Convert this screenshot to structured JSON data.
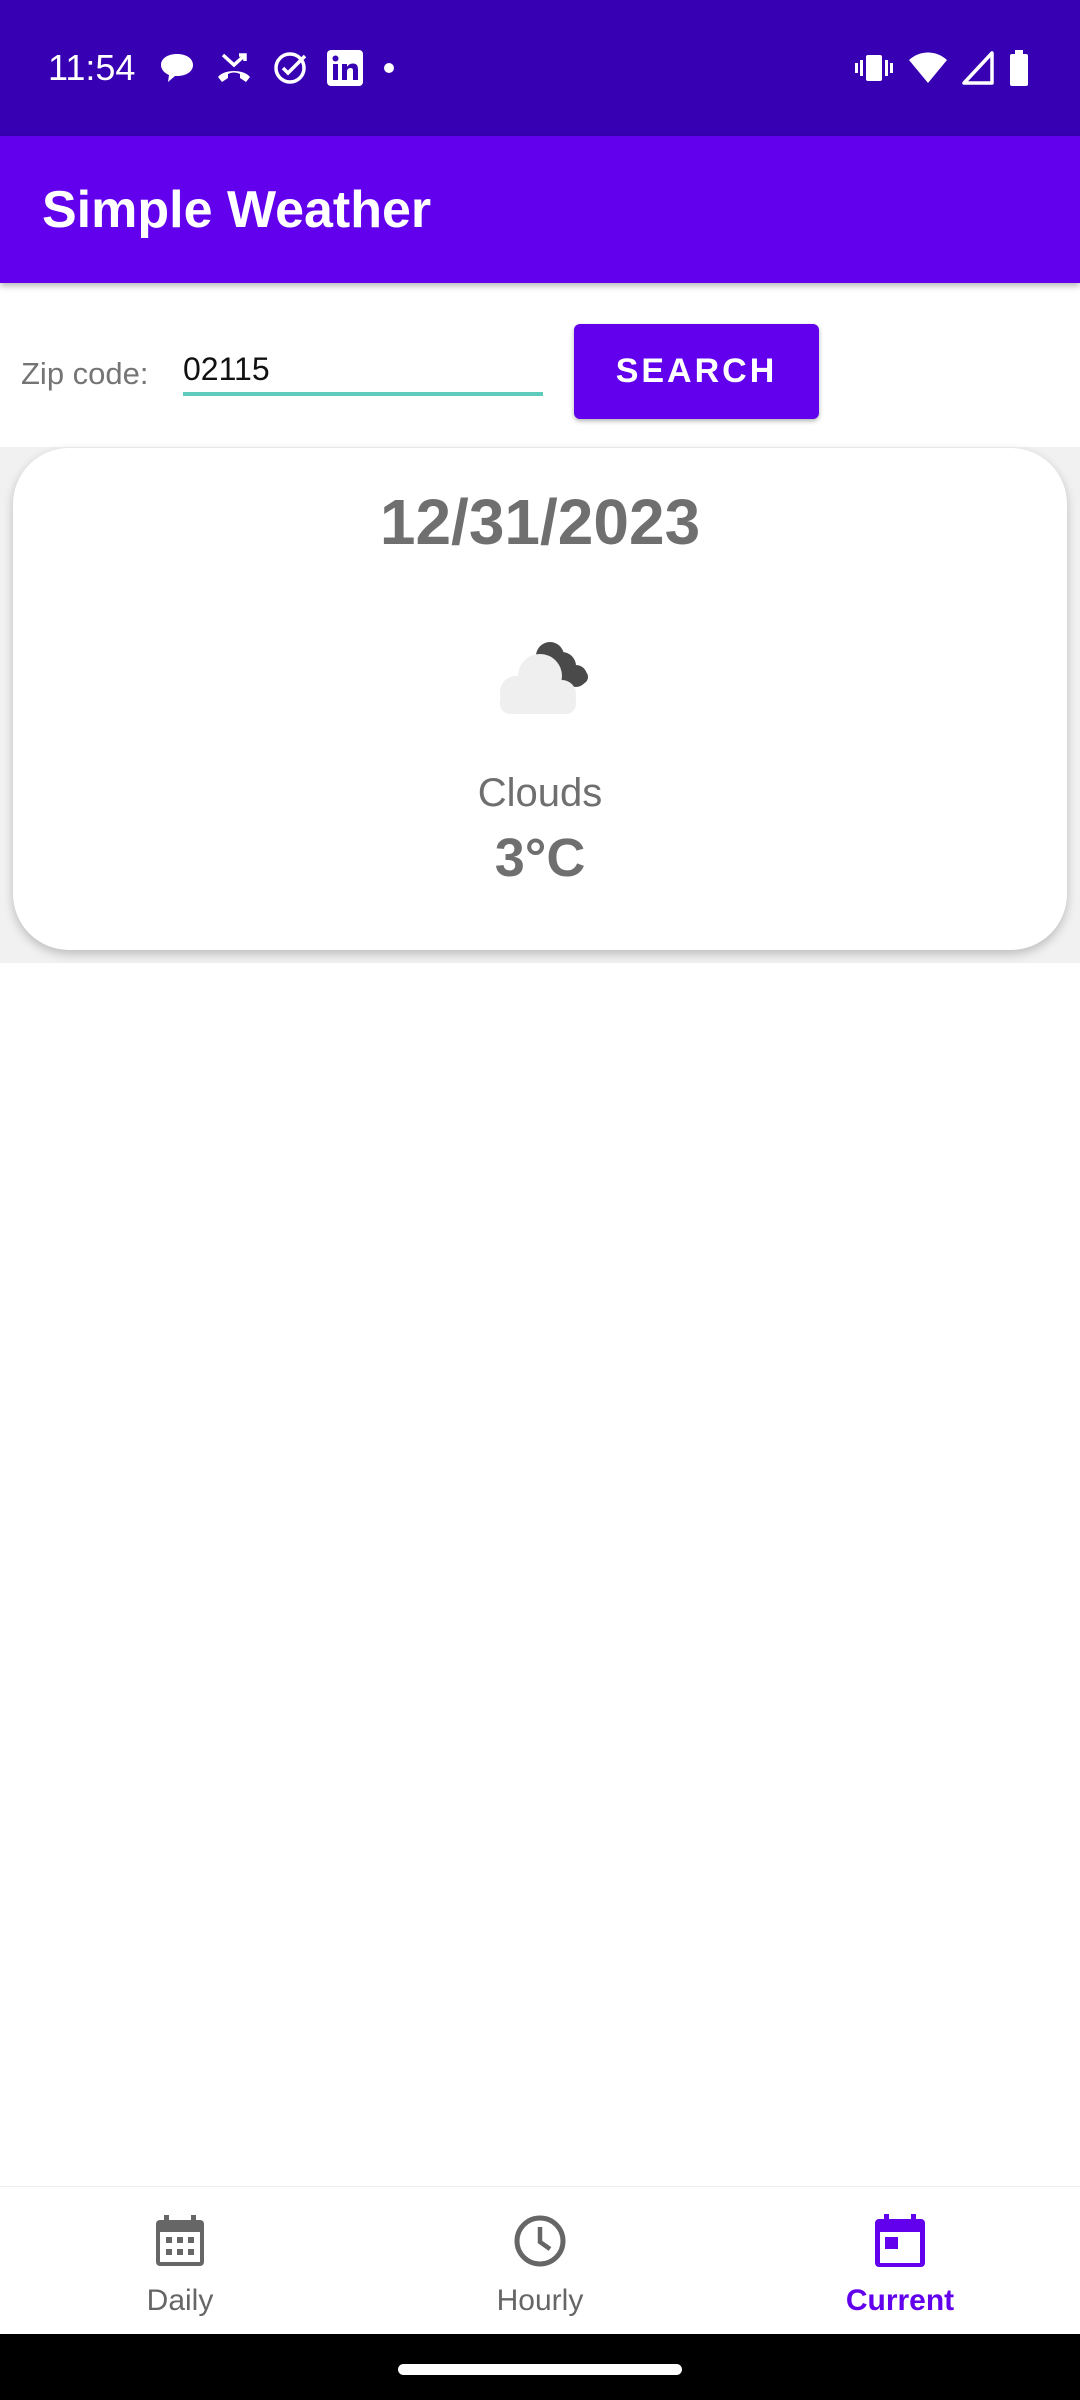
{
  "status_bar": {
    "time": "11:54",
    "notification_icons": [
      "chat-bubble-icon",
      "missed-call-icon",
      "check-circle-icon",
      "linkedin-icon",
      "dot-icon"
    ],
    "system_icons": [
      "vibrate-icon",
      "wifi-icon",
      "cell-signal-icon",
      "battery-icon"
    ]
  },
  "app_bar": {
    "title": "Simple Weather"
  },
  "search": {
    "label": "Zip code:",
    "value": "02115",
    "button_label": "SEARCH"
  },
  "weather_card": {
    "date": "12/31/2023",
    "icon": "clouds-icon",
    "description": "Clouds",
    "temperature": "3°C"
  },
  "bottom_nav": {
    "items": [
      {
        "label": "Daily",
        "icon": "calendar-grid-icon",
        "active": false
      },
      {
        "label": "Hourly",
        "icon": "clock-icon",
        "active": false
      },
      {
        "label": "Current",
        "icon": "calendar-today-icon",
        "active": true
      }
    ]
  },
  "colors": {
    "status_bar": "#3700b3",
    "primary": "#6200ee",
    "input_underline": "#5fcbbb",
    "card_text": "#6f6f6f"
  }
}
